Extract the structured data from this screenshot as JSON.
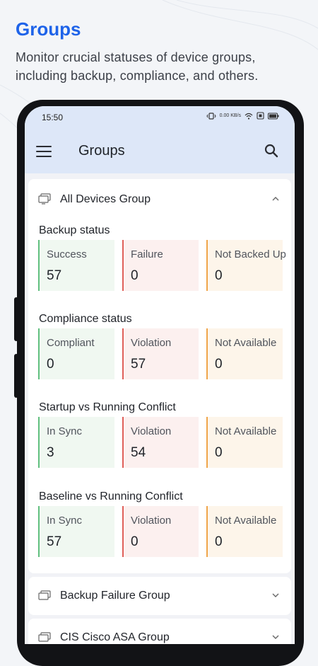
{
  "promo": {
    "title": "Groups",
    "subtitle": "Monitor crucial statuses of device groups, including backup, compliance, and others."
  },
  "status_bar": {
    "time": "15:50",
    "icons": [
      "vibrate-icon",
      "data-speed-icon",
      "wifi-icon",
      "sim-icon",
      "battery-icon"
    ],
    "data_speed": "0.00 KB/s"
  },
  "app_bar": {
    "title": "Groups",
    "menu_icon": "hamburger-menu-icon",
    "search_icon": "search-icon"
  },
  "colors": {
    "accent": "#1e63e9",
    "appbar": "#dde7f8",
    "success": "#62c080",
    "failure": "#e0605a",
    "warning": "#f0a54a"
  },
  "groups": [
    {
      "name": "All Devices Group",
      "expanded": true,
      "sections": [
        {
          "title": "Backup status",
          "stats": [
            {
              "label": "Success",
              "value": "57"
            },
            {
              "label": "Failure",
              "value": "0"
            },
            {
              "label": "Not Backed Up",
              "value": "0"
            }
          ]
        },
        {
          "title": "Compliance status",
          "stats": [
            {
              "label": "Compliant",
              "value": "0"
            },
            {
              "label": "Violation",
              "value": "57"
            },
            {
              "label": "Not Available",
              "value": "0"
            }
          ]
        },
        {
          "title": "Startup vs Running Conflict",
          "stats": [
            {
              "label": "In Sync",
              "value": "3"
            },
            {
              "label": "Violation",
              "value": "54"
            },
            {
              "label": "Not Available",
              "value": "0"
            }
          ]
        },
        {
          "title": "Baseline vs Running Conflict",
          "stats": [
            {
              "label": "In Sync",
              "value": "57"
            },
            {
              "label": "Violation",
              "value": "0"
            },
            {
              "label": "Not Available",
              "value": "0"
            }
          ]
        }
      ]
    },
    {
      "name": "Backup Failure Group",
      "expanded": false
    },
    {
      "name": "CIS Cisco ASA Group",
      "expanded": false
    }
  ]
}
